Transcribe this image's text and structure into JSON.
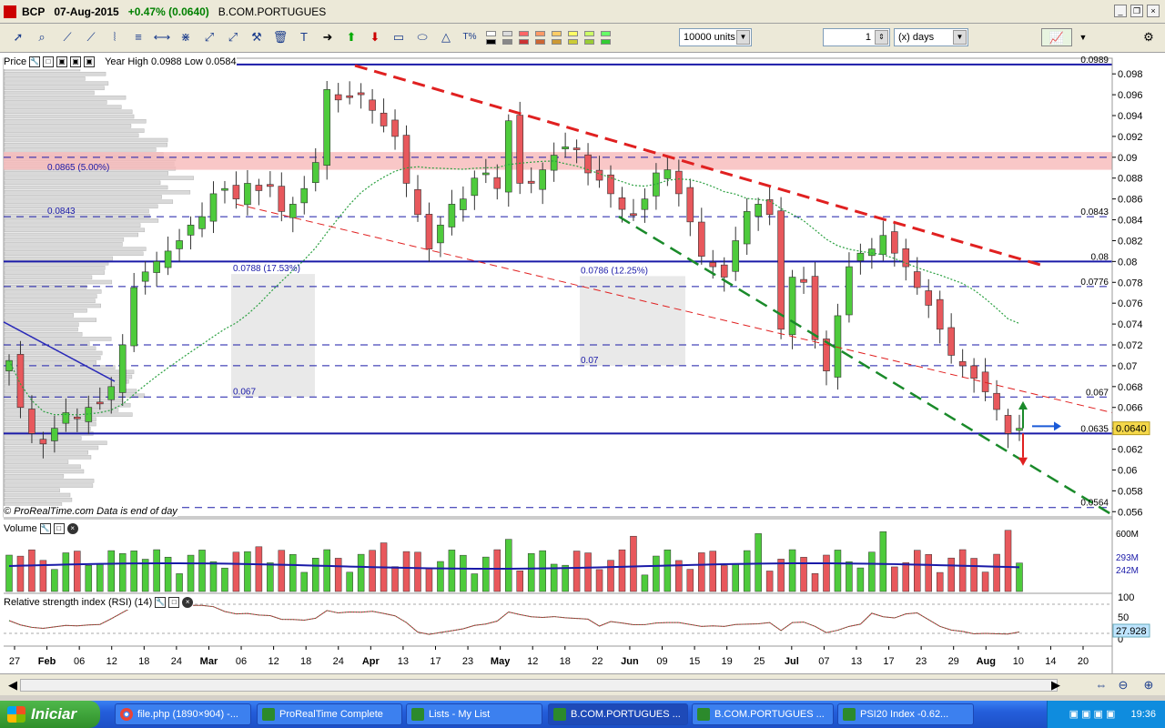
{
  "window": {
    "symbol": "BCP",
    "date": "07-Aug-2015",
    "change": "+0.47% (0.0640)",
    "name": "B.COM.PORTUGUES"
  },
  "toolbar": {
    "units_value": "10000 units",
    "period_value": "1",
    "period_unit": "(x) days"
  },
  "price_panel": {
    "label": "Price",
    "year_info": "Year High 0.0988 Low 0.0584",
    "footer": "© ProRealTime.com  Data is end of day",
    "current_price": "0.0640",
    "level_tags": [
      "0.0989",
      "0.0843",
      "0.08",
      "0.0776",
      "0.067",
      "0.0635",
      "0.0564"
    ],
    "annotations": [
      "0.0865 (5.00%)",
      "0.0843",
      "0.0788 (17.53%)",
      "0.0786 (12.25%)",
      "0.07",
      "0.067"
    ]
  },
  "volume_panel": {
    "label": "Volume",
    "axis_labels": [
      "600M",
      "293M",
      "242M"
    ]
  },
  "rsi_panel": {
    "label": "Relative strength index (RSI) (14)",
    "axis_labels": [
      "100",
      "50",
      "0"
    ],
    "current_value": "27.928"
  },
  "chart_data": {
    "type": "candlestick",
    "title": "BCP",
    "ylim": [
      0.0555,
      0.0995
    ],
    "y_ticks": [
      0.098,
      0.096,
      0.094,
      0.092,
      0.09,
      0.088,
      0.086,
      0.084,
      0.082,
      0.08,
      0.078,
      0.076,
      0.074,
      0.072,
      0.07,
      0.068,
      0.066,
      0.064,
      0.062,
      0.06,
      0.058,
      0.056
    ],
    "x_ticks": [
      "27",
      "Feb",
      "06",
      "12",
      "18",
      "24",
      "Mar",
      "06",
      "12",
      "18",
      "24",
      "Apr",
      "13",
      "17",
      "23",
      "May",
      "12",
      "18",
      "22",
      "Jun",
      "09",
      "15",
      "19",
      "25",
      "Jul",
      "07",
      "13",
      "17",
      "23",
      "29",
      "Aug",
      "10",
      "14",
      "20"
    ],
    "close_series": [
      0.0705,
      0.066,
      0.0635,
      0.0625,
      0.064,
      0.0655,
      0.065,
      0.066,
      0.0665,
      0.068,
      0.072,
      0.0775,
      0.079,
      0.08,
      0.081,
      0.082,
      0.0835,
      0.0843,
      0.0865,
      0.087,
      0.086,
      0.0875,
      0.0868,
      0.0872,
      0.0848,
      0.0855,
      0.087,
      0.0895,
      0.0965,
      0.0955,
      0.0958,
      0.096,
      0.0945,
      0.093,
      0.092,
      0.0875,
      0.0845,
      0.0812,
      0.0835,
      0.0855,
      0.086,
      0.088,
      0.0885,
      0.087,
      0.0935,
      0.0875,
      0.0875,
      0.0888,
      0.0902,
      0.091,
      0.0908,
      0.0885,
      0.0878,
      0.0865,
      0.085,
      0.0845,
      0.086,
      0.0885,
      0.0888,
      0.0865,
      0.0838,
      0.0805,
      0.0795,
      0.0785,
      0.082,
      0.0848,
      0.0855,
      0.0845,
      0.0735,
      0.0785,
      0.078,
      0.0725,
      0.0695,
      0.0748,
      0.0795,
      0.0808,
      0.0812,
      0.0825,
      0.0808,
      0.0795,
      0.0775,
      0.0758,
      0.0735,
      0.071,
      0.07,
      0.0688,
      0.0675,
      0.0658,
      0.0635,
      0.064
    ],
    "horizontal_levels": [
      0.0989,
      0.09,
      0.0843,
      0.08,
      0.0776,
      0.072,
      0.07,
      0.067,
      0.0635,
      0.0564
    ],
    "volume": {
      "y_labels": [
        "600M",
        "293M",
        "242M"
      ]
    },
    "rsi": {
      "period": 14,
      "last": 27.928,
      "y_labels": [
        "100",
        "50",
        "0"
      ]
    },
    "legend": "none"
  }
}
